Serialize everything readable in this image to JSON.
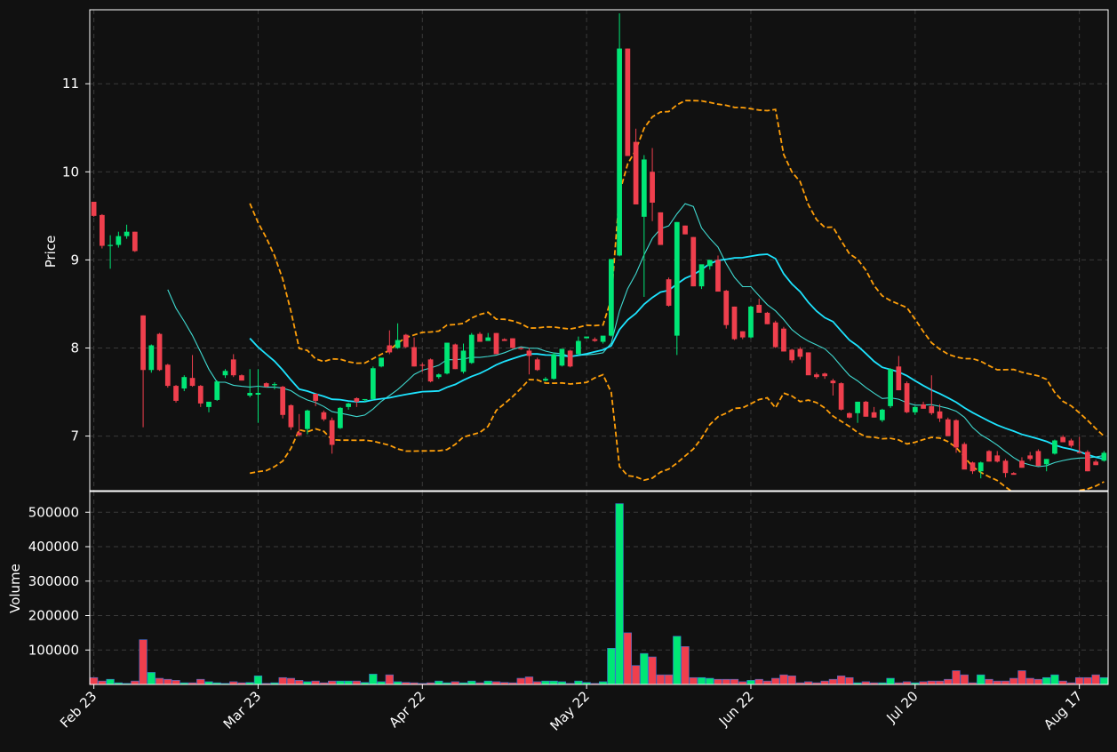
{
  "chart_data": {
    "type": "candlestick",
    "colors": {
      "background": "#111111",
      "frame": "#ffffff",
      "grid": "#3a3a3a",
      "text": "#ffffff",
      "up": "#00e676",
      "down": "#ef3f4d",
      "volume_edge": "#3a6fd0",
      "bollinger": "#ff9f0a",
      "ma_slow": "#1de4ff",
      "ma_fast": "#3fd9d0"
    },
    "price_axis": {
      "label": "Price",
      "ylim": [
        6.38,
        11.84
      ],
      "ticks": [
        7,
        8,
        9,
        10,
        11
      ]
    },
    "volume_axis": {
      "label": "Volume",
      "ylim": [
        0,
        560000
      ],
      "ticks": [
        100000,
        200000,
        300000,
        400000,
        500000
      ]
    },
    "x_ticks": [
      {
        "label": "Feb 23",
        "index": 0
      },
      {
        "label": "Mar 23",
        "index": 20
      },
      {
        "label": "Apr 22",
        "index": 40
      },
      {
        "label": "May 22",
        "index": 60
      },
      {
        "label": "Jun 22",
        "index": 80
      },
      {
        "label": "Jul 20",
        "index": 100
      },
      {
        "label": "Aug 17",
        "index": 120
      }
    ],
    "grid": true,
    "ohlcv": [
      [
        9.66,
        9.66,
        9.49,
        9.5,
        20000
      ],
      [
        9.51,
        9.52,
        9.13,
        9.16,
        10000
      ],
      [
        9.16,
        9.28,
        8.9,
        9.17,
        15000
      ],
      [
        9.17,
        9.32,
        9.14,
        9.27,
        5000
      ],
      [
        9.27,
        9.4,
        9.24,
        9.32,
        3000
      ],
      [
        9.32,
        9.32,
        9.09,
        9.1,
        10000
      ],
      [
        8.37,
        8.37,
        7.1,
        7.75,
        130000
      ],
      [
        7.75,
        8.04,
        7.72,
        8.03,
        35000
      ],
      [
        8.16,
        8.17,
        7.74,
        7.75,
        18000
      ],
      [
        7.81,
        7.82,
        7.55,
        7.57,
        15000
      ],
      [
        7.57,
        7.58,
        7.38,
        7.4,
        12000
      ],
      [
        7.54,
        7.69,
        7.51,
        7.67,
        5000
      ],
      [
        7.66,
        7.92,
        7.56,
        7.57,
        5000
      ],
      [
        7.57,
        7.58,
        7.33,
        7.37,
        15000
      ],
      [
        7.33,
        7.36,
        7.27,
        7.39,
        8000
      ],
      [
        7.41,
        7.63,
        7.4,
        7.62,
        5000
      ],
      [
        7.69,
        7.76,
        7.66,
        7.74,
        3000
      ],
      [
        7.87,
        7.93,
        7.67,
        7.69,
        8000
      ],
      [
        7.69,
        7.7,
        7.63,
        7.63,
        5000
      ],
      [
        7.46,
        7.76,
        7.44,
        7.49,
        6000
      ],
      [
        7.47,
        7.76,
        7.15,
        7.49,
        25000
      ],
      [
        7.6,
        7.61,
        7.55,
        7.56,
        3000
      ],
      [
        7.59,
        7.61,
        7.53,
        7.59,
        5000
      ],
      [
        7.56,
        7.57,
        7.2,
        7.24,
        20000
      ],
      [
        7.35,
        7.36,
        7.07,
        7.1,
        18000
      ],
      [
        7.04,
        7.25,
        7.0,
        7.01,
        12000
      ],
      [
        7.08,
        7.3,
        7.02,
        7.29,
        8000
      ],
      [
        7.48,
        7.48,
        7.34,
        7.4,
        10000
      ],
      [
        7.27,
        7.29,
        7.17,
        7.19,
        5000
      ],
      [
        7.18,
        7.21,
        6.8,
        6.9,
        10000
      ],
      [
        7.09,
        7.33,
        7.08,
        7.32,
        10000
      ],
      [
        7.33,
        7.38,
        7.3,
        7.37,
        10000
      ],
      [
        7.43,
        7.44,
        7.33,
        7.39,
        10000
      ],
      [
        7.41,
        7.42,
        7.39,
        7.42,
        6000
      ],
      [
        7.42,
        7.79,
        7.41,
        7.77,
        30000
      ],
      [
        7.79,
        7.88,
        7.78,
        7.89,
        8000
      ],
      [
        8.03,
        8.2,
        7.93,
        7.95,
        28000
      ],
      [
        8.0,
        8.28,
        7.99,
        8.09,
        8000
      ],
      [
        8.15,
        8.16,
        8.0,
        8.01,
        6000
      ],
      [
        8.01,
        8.12,
        7.79,
        7.79,
        5000
      ],
      [
        7.81,
        7.83,
        7.73,
        7.8,
        3000
      ],
      [
        7.87,
        7.88,
        7.61,
        7.62,
        5000
      ],
      [
        7.67,
        7.71,
        7.65,
        7.7,
        10000
      ],
      [
        7.71,
        8.03,
        7.7,
        8.06,
        5000
      ],
      [
        8.04,
        8.05,
        7.76,
        7.76,
        8000
      ],
      [
        7.73,
        8.05,
        7.71,
        7.97,
        5000
      ],
      [
        7.83,
        8.17,
        7.82,
        8.15,
        10000
      ],
      [
        8.16,
        8.18,
        8.07,
        8.07,
        5000
      ],
      [
        8.08,
        8.17,
        8.08,
        8.12,
        10000
      ],
      [
        8.17,
        8.17,
        7.93,
        7.93,
        8000
      ],
      [
        8.1,
        8.11,
        8.08,
        8.08,
        6000
      ],
      [
        8.11,
        8.11,
        7.99,
        8.0,
        5000
      ],
      [
        8.0,
        8.01,
        7.98,
        7.99,
        18000
      ],
      [
        7.97,
        8.0,
        7.7,
        7.91,
        22000
      ],
      [
        7.87,
        7.89,
        7.74,
        7.75,
        8000
      ],
      [
        7.63,
        7.67,
        7.62,
        7.65,
        10000
      ],
      [
        7.65,
        7.95,
        7.64,
        7.93,
        10000
      ],
      [
        7.8,
        7.97,
        7.79,
        7.99,
        8000
      ],
      [
        7.97,
        7.98,
        7.78,
        7.79,
        3000
      ],
      [
        7.93,
        8.13,
        7.92,
        8.08,
        10000
      ],
      [
        8.11,
        8.12,
        8.11,
        8.13,
        6000
      ],
      [
        8.1,
        8.12,
        8.07,
        8.08,
        3000
      ],
      [
        8.07,
        8.13,
        8.05,
        8.14,
        8000
      ],
      [
        8.14,
        9.01,
        8.13,
        9.01,
        105000
      ],
      [
        9.05,
        11.8,
        9.04,
        11.4,
        525000
      ],
      [
        11.4,
        11.4,
        10.18,
        10.18,
        150000
      ],
      [
        10.34,
        10.49,
        9.96,
        9.63,
        55000
      ],
      [
        9.49,
        10.19,
        8.58,
        10.14,
        90000
      ],
      [
        10.0,
        10.27,
        9.44,
        9.65,
        80000
      ],
      [
        9.54,
        9.54,
        9.17,
        9.17,
        28000
      ],
      [
        8.78,
        8.8,
        8.47,
        8.48,
        28000
      ],
      [
        8.14,
        9.43,
        7.92,
        9.43,
        140000
      ],
      [
        9.39,
        9.39,
        9.29,
        9.29,
        110000
      ],
      [
        9.26,
        9.26,
        8.7,
        8.7,
        20000
      ],
      [
        8.7,
        8.89,
        8.67,
        8.95,
        20000
      ],
      [
        8.93,
        9.0,
        8.89,
        9.0,
        18000
      ],
      [
        9.0,
        9.05,
        8.95,
        8.64,
        15000
      ],
      [
        8.65,
        8.66,
        8.22,
        8.26,
        15000
      ],
      [
        8.47,
        8.47,
        8.09,
        8.1,
        15000
      ],
      [
        8.19,
        8.19,
        8.1,
        8.12,
        8000
      ],
      [
        8.12,
        8.48,
        8.11,
        8.47,
        12000
      ],
      [
        8.49,
        8.56,
        8.41,
        8.4,
        15000
      ],
      [
        8.4,
        8.41,
        8.27,
        8.27,
        10000
      ],
      [
        8.29,
        8.31,
        8.0,
        8.01,
        18000
      ],
      [
        8.22,
        8.24,
        7.96,
        7.96,
        28000
      ],
      [
        7.98,
        7.99,
        7.83,
        7.86,
        25000
      ],
      [
        7.99,
        8.01,
        7.87,
        7.9,
        5000
      ],
      [
        7.95,
        7.95,
        7.72,
        7.69,
        8000
      ],
      [
        7.7,
        7.72,
        7.65,
        7.67,
        5000
      ],
      [
        7.71,
        7.72,
        7.65,
        7.68,
        10000
      ],
      [
        7.63,
        7.65,
        7.46,
        7.6,
        15000
      ],
      [
        7.6,
        7.61,
        7.29,
        7.3,
        25000
      ],
      [
        7.26,
        7.27,
        7.2,
        7.21,
        20000
      ],
      [
        7.26,
        7.39,
        7.15,
        7.39,
        5000
      ],
      [
        7.39,
        7.4,
        7.22,
        7.22,
        8000
      ],
      [
        7.27,
        7.33,
        7.21,
        7.21,
        5000
      ],
      [
        7.18,
        7.31,
        7.16,
        7.3,
        5000
      ],
      [
        7.34,
        7.77,
        7.32,
        7.76,
        18000
      ],
      [
        7.79,
        7.91,
        7.52,
        7.52,
        5000
      ],
      [
        7.6,
        7.62,
        7.26,
        7.27,
        8000
      ],
      [
        7.27,
        7.34,
        7.24,
        7.33,
        5000
      ],
      [
        7.36,
        7.39,
        7.32,
        7.31,
        8000
      ],
      [
        7.34,
        7.69,
        7.24,
        7.26,
        10000
      ],
      [
        7.28,
        7.36,
        7.16,
        7.2,
        10000
      ],
      [
        7.19,
        7.21,
        7.0,
        7.0,
        15000
      ],
      [
        7.18,
        7.19,
        6.81,
        6.87,
        40000
      ],
      [
        6.91,
        6.93,
        6.63,
        6.62,
        28000
      ],
      [
        6.7,
        6.71,
        6.57,
        6.6,
        5000
      ],
      [
        6.6,
        6.71,
        6.52,
        6.7,
        28000
      ],
      [
        6.83,
        6.84,
        6.71,
        6.71,
        15000
      ],
      [
        6.78,
        6.83,
        6.7,
        6.71,
        10000
      ],
      [
        6.72,
        6.74,
        6.53,
        6.58,
        10000
      ],
      [
        6.58,
        6.59,
        6.57,
        6.56,
        18000
      ],
      [
        6.72,
        6.76,
        6.64,
        6.64,
        40000
      ],
      [
        6.78,
        6.82,
        6.72,
        6.74,
        18000
      ],
      [
        6.83,
        6.85,
        6.66,
        6.66,
        15000
      ],
      [
        6.68,
        6.74,
        6.6,
        6.74,
        20000
      ],
      [
        6.8,
        6.96,
        6.79,
        6.95,
        28000
      ],
      [
        6.99,
        7.01,
        6.93,
        6.93,
        10000
      ],
      [
        6.95,
        6.97,
        6.87,
        6.89,
        5000
      ],
      [
        6.82,
        6.99,
        6.81,
        6.81,
        20000
      ],
      [
        6.82,
        6.84,
        6.6,
        6.6,
        20000
      ],
      [
        6.71,
        6.73,
        6.67,
        6.67,
        28000
      ],
      [
        6.72,
        6.83,
        6.71,
        6.81,
        20000
      ]
    ]
  }
}
